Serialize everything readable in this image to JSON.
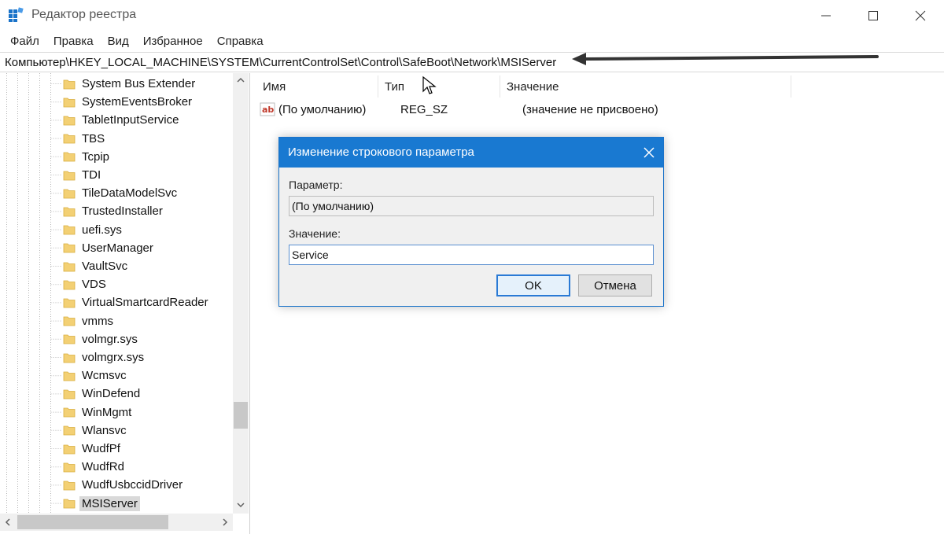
{
  "window": {
    "title": "Редактор реестра"
  },
  "menu": [
    "Файл",
    "Правка",
    "Вид",
    "Избранное",
    "Справка"
  ],
  "address": {
    "path": "Компьютер\\HKEY_LOCAL_MACHINE\\SYSTEM\\CurrentControlSet\\Control\\SafeBoot\\Network\\MSIServer"
  },
  "tree": {
    "items": [
      "System Bus Extender",
      "SystemEventsBroker",
      "TabletInputService",
      "TBS",
      "Tcpip",
      "TDI",
      "TileDataModelSvc",
      "TrustedInstaller",
      "uefi.sys",
      "UserManager",
      "VaultSvc",
      "VDS",
      "VirtualSmartcardReader",
      "vmms",
      "volmgr.sys",
      "volmgrx.sys",
      "Wcmsvc",
      "WinDefend",
      "WinMgmt",
      "Wlansvc",
      "WudfPf",
      "WudfRd",
      "WudfUsbccidDriver",
      "MSIServer"
    ],
    "selected_index": 23
  },
  "list": {
    "columns": [
      "Имя",
      "Тип",
      "Значение"
    ],
    "rows": [
      {
        "name": "(По умолчанию)",
        "type": "REG_SZ",
        "value": "(значение не присвоено)",
        "icon": "string-value-icon"
      }
    ]
  },
  "dialog": {
    "title": "Изменение строкового параметра",
    "param_label": "Параметр:",
    "param_value": "(По умолчанию)",
    "value_label": "Значение:",
    "value": "Service",
    "ok_label": "OK",
    "cancel_label": "Отмена"
  },
  "colors": {
    "accent": "#1979d1",
    "folder": "#f3d074",
    "selection": "#d9d9d9"
  }
}
